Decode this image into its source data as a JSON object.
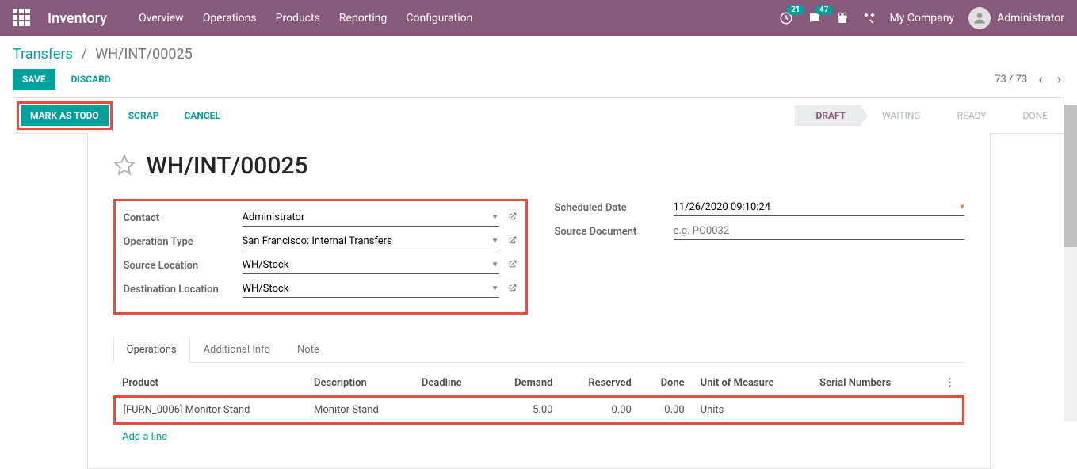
{
  "header": {
    "app_name": "Inventory",
    "menu": [
      "Overview",
      "Operations",
      "Products",
      "Reporting",
      "Configuration"
    ],
    "clock_badge": "21",
    "chat_badge": "47",
    "company": "My Company",
    "user": "Administrator"
  },
  "breadcrumb": {
    "root": "Transfers",
    "current": "WH/INT/00025"
  },
  "actions": {
    "save": "Save",
    "discard": "Discard",
    "mark_todo": "Mark as Todo",
    "scrap": "Scrap",
    "cancel": "Cancel"
  },
  "pager": {
    "text": "73 / 73"
  },
  "status": {
    "steps": [
      "Draft",
      "Waiting",
      "Ready",
      "Done"
    ],
    "active": "Draft"
  },
  "record": {
    "title": "WH/INT/00025",
    "left": {
      "contact_label": "Contact",
      "contact_value": "Administrator",
      "optype_label": "Operation Type",
      "optype_value": "San Francisco: Internal Transfers",
      "srcloc_label": "Source Location",
      "srcloc_value": "WH/Stock",
      "dstloc_label": "Destination Location",
      "dstloc_value": "WH/Stock"
    },
    "right": {
      "sched_label": "Scheduled Date",
      "sched_value": "11/26/2020 09:10:24",
      "srcdoc_label": "Source Document",
      "srcdoc_placeholder": "e.g. PO0032"
    }
  },
  "tabs": [
    "Operations",
    "Additional Info",
    "Note"
  ],
  "table": {
    "headers": {
      "product": "Product",
      "description": "Description",
      "deadline": "Deadline",
      "demand": "Demand",
      "reserved": "Reserved",
      "done": "Done",
      "uom": "Unit of Measure",
      "serial": "Serial Numbers"
    },
    "row": {
      "product": "[FURN_0006] Monitor Stand",
      "description": "Monitor Stand",
      "deadline": "",
      "demand": "5.00",
      "reserved": "0.00",
      "done": "0.00",
      "uom": "Units",
      "serial": ""
    },
    "add_line": "Add a line"
  }
}
